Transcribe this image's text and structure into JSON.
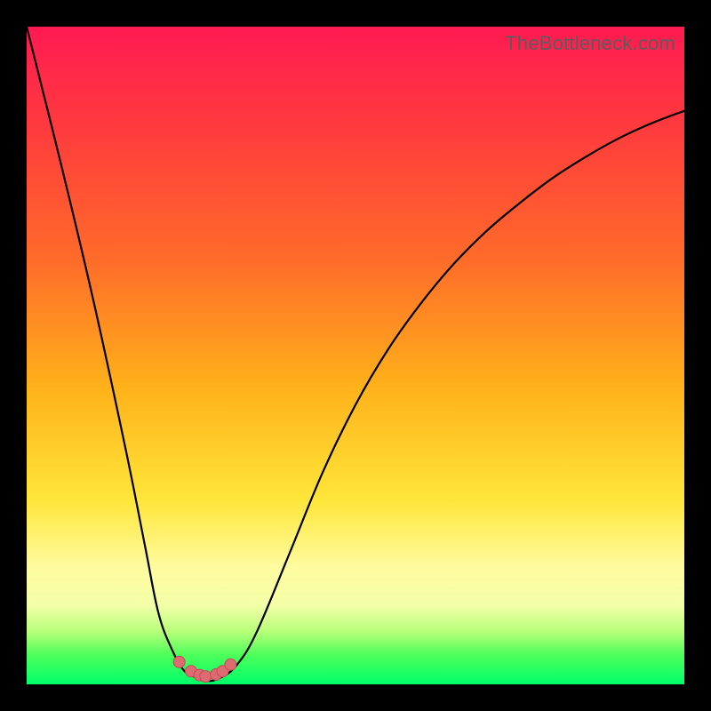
{
  "attribution": "TheBottleneck.com",
  "chart_data": {
    "type": "line",
    "title": "",
    "xlabel": "",
    "ylabel": "",
    "xlim": [
      0,
      1
    ],
    "ylim": [
      0,
      1
    ],
    "series": [
      {
        "name": "bottleneck-curve",
        "x": [
          0.0,
          0.05,
          0.1,
          0.15,
          0.18,
          0.2,
          0.22,
          0.24,
          0.26,
          0.275,
          0.295,
          0.32,
          0.35,
          0.4,
          0.45,
          0.5,
          0.55,
          0.6,
          0.65,
          0.7,
          0.75,
          0.8,
          0.85,
          0.9,
          0.95,
          1.0
        ],
        "values": [
          1.0,
          0.8,
          0.59,
          0.36,
          0.21,
          0.11,
          0.055,
          0.02,
          0.01,
          0.005,
          0.01,
          0.03,
          0.08,
          0.2,
          0.322,
          0.425,
          0.51,
          0.58,
          0.64,
          0.69,
          0.732,
          0.77,
          0.802,
          0.83,
          0.853,
          0.872
        ]
      },
      {
        "name": "marker-cluster",
        "x": [
          0.232,
          0.25,
          0.263,
          0.272,
          0.288,
          0.298,
          0.31
        ],
        "values": [
          0.034,
          0.02,
          0.014,
          0.012,
          0.015,
          0.02,
          0.03
        ]
      }
    ]
  },
  "colors": {
    "curve": "#000000",
    "marker_fill": "#de6b72",
    "marker_stroke": "#c44a55"
  }
}
